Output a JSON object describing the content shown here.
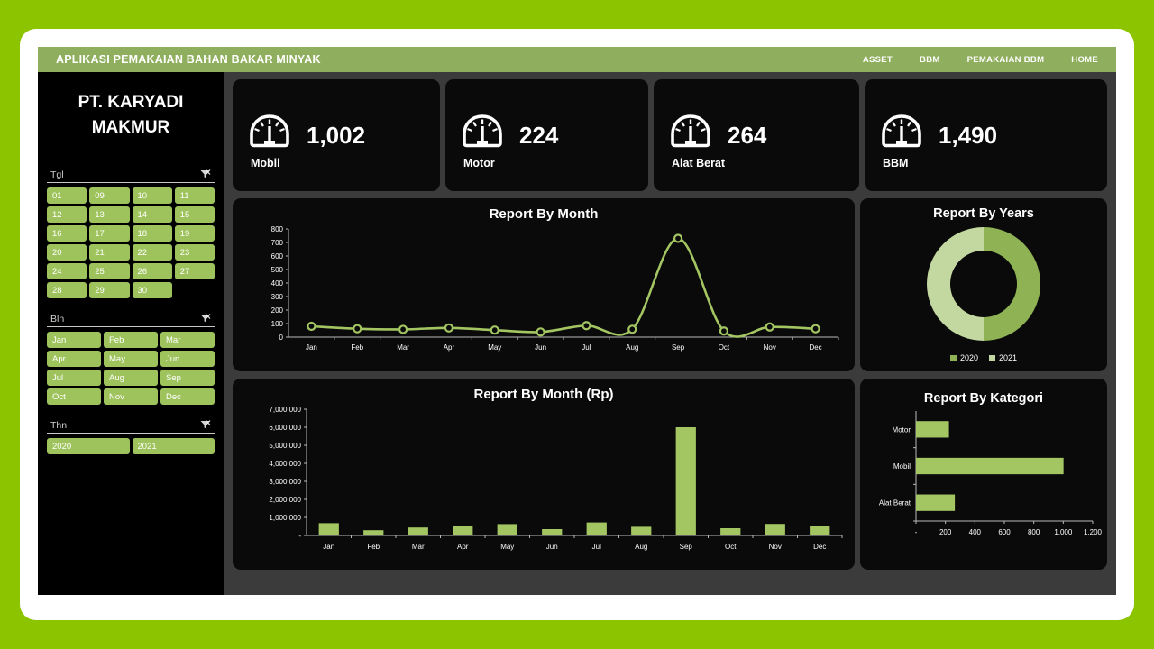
{
  "theme": {
    "page_green": "#8dc400",
    "header_green": "#8fae5e",
    "tile_green": "#9ec35d",
    "chart_green": "#a3c562",
    "donut_2020": "#8fb css",
    "panel_black": "#0a0a0a",
    "content_grey": "#3b3b3b"
  },
  "header": {
    "title": "APLIKASI PEMAKAIAN BAHAN BAKAR MINYAK",
    "nav": [
      {
        "label": "ASSET"
      },
      {
        "label": "BBM"
      },
      {
        "label": "PEMAKAIAN BBM"
      },
      {
        "label": "HOME"
      }
    ]
  },
  "sidebar": {
    "company_line1": "PT. KARYADI",
    "company_line2": "MAKMUR",
    "slicers": [
      {
        "title": "Tgl",
        "clear_icon": "clear-filter-icon",
        "columns": 4,
        "items": [
          "01",
          "09",
          "10",
          "11",
          "12",
          "13",
          "14",
          "15",
          "16",
          "17",
          "18",
          "19",
          "20",
          "21",
          "22",
          "23",
          "24",
          "25",
          "26",
          "27",
          "28",
          "29",
          "30"
        ]
      },
      {
        "title": "Bln",
        "clear_icon": "clear-filter-icon",
        "columns": 3,
        "items": [
          "Jan",
          "Feb",
          "Mar",
          "Apr",
          "May",
          "Jun",
          "Jul",
          "Aug",
          "Sep",
          "Oct",
          "Nov",
          "Dec"
        ]
      },
      {
        "title": "Thn",
        "clear_icon": "clear-filter-icon",
        "columns": 2,
        "items": [
          "2020",
          "2021"
        ]
      }
    ]
  },
  "kpis": [
    {
      "icon": "fuel-gauge-icon",
      "value": "1,002",
      "label": "Mobil"
    },
    {
      "icon": "fuel-gauge-icon",
      "value": "224",
      "label": "Motor"
    },
    {
      "icon": "fuel-gauge-icon",
      "value": "264",
      "label": "Alat Berat"
    },
    {
      "icon": "fuel-gauge-icon",
      "value": "1,490",
      "label": "BBM"
    }
  ],
  "chart_data": [
    {
      "id": "report-by-month",
      "type": "line",
      "title": "Report By Month",
      "xlabel": "",
      "ylabel": "",
      "categories": [
        "Jan",
        "Feb",
        "Mar",
        "Apr",
        "May",
        "Jun",
        "Jul",
        "Aug",
        "Sep",
        "Oct",
        "Nov",
        "Dec"
      ],
      "values": [
        80,
        62,
        57,
        68,
        52,
        38,
        85,
        58,
        730,
        45,
        75,
        62
      ],
      "ylim": [
        0,
        800
      ],
      "yticks": [
        0,
        100,
        200,
        300,
        400,
        500,
        600,
        700,
        800
      ],
      "ytick_labels": [
        "0",
        "100",
        "200",
        "300",
        "400",
        "500",
        "600",
        "700",
        "800"
      ],
      "grid": false,
      "markers": true,
      "series_color": "#a3c562",
      "legend": "none"
    },
    {
      "id": "report-by-years",
      "type": "pie",
      "title": "Report By Years",
      "donut": true,
      "labels": [
        "2020",
        "2021"
      ],
      "values": [
        50,
        50
      ],
      "colors": [
        "#8fb255",
        "#c3d8a0"
      ],
      "legend": "bottom",
      "legend_entries": [
        {
          "label": "2020",
          "color": "#8fb255"
        },
        {
          "label": "2021",
          "color": "#c3d8a0"
        }
      ]
    },
    {
      "id": "report-by-month-rp",
      "type": "bar",
      "title": "Report By Month (Rp)",
      "xlabel": "",
      "ylabel": "",
      "categories": [
        "Jan",
        "Feb",
        "Mar",
        "Apr",
        "May",
        "Jun",
        "Jul",
        "Aug",
        "Sep",
        "Oct",
        "Nov",
        "Dec"
      ],
      "values": [
        680000,
        290000,
        440000,
        520000,
        630000,
        350000,
        720000,
        480000,
        6000000,
        400000,
        640000,
        530000
      ],
      "ylim": [
        0,
        7000000
      ],
      "yticks": [
        0,
        1000000,
        2000000,
        3000000,
        4000000,
        5000000,
        6000000,
        7000000
      ],
      "ytick_labels": [
        "-",
        "1,000,000",
        "2,000,000",
        "3,000,000",
        "4,000,000",
        "5,000,000",
        "6,000,000",
        "7,000,000"
      ],
      "grid": false,
      "series_color": "#a3c562",
      "legend": "none"
    },
    {
      "id": "report-by-kategori",
      "type": "bar",
      "orientation": "horizontal",
      "title": "Report By Kategori",
      "xlabel": "",
      "ylabel": "",
      "categories": [
        "Motor",
        "Mobil",
        "Alat Berat"
      ],
      "values": [
        224,
        1002,
        264
      ],
      "xlim": [
        0,
        1200
      ],
      "xticks": [
        0,
        200,
        400,
        600,
        800,
        1000,
        1200
      ],
      "xtick_labels": [
        "-",
        "200",
        "400",
        "600",
        "800",
        "1,000",
        "1,200"
      ],
      "grid": false,
      "series_color": "#a3c562",
      "legend": "none"
    }
  ]
}
